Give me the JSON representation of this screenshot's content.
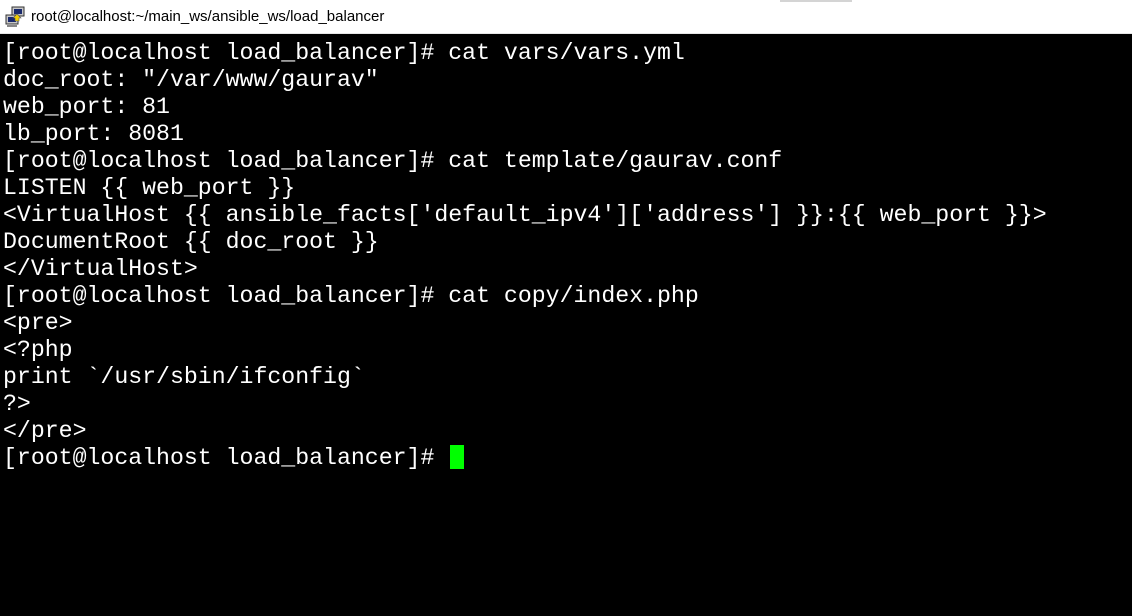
{
  "window": {
    "title": "root@localhost:~/main_ws/ansible_ws/load_balancer",
    "icon": "putty-terminal-icon"
  },
  "terminal": {
    "lines": [
      "[root@localhost load_balancer]# cat vars/vars.yml",
      "doc_root: \"/var/www/gaurav\"",
      "web_port: 81",
      "lb_port: 8081",
      "[root@localhost load_balancer]# cat template/gaurav.conf",
      "LISTEN {{ web_port }}",
      "<VirtualHost {{ ansible_facts['default_ipv4']['address'] }}:{{ web_port }}>",
      "DocumentRoot {{ doc_root }}",
      "</VirtualHost>",
      "[root@localhost load_balancer]# cat copy/index.php",
      "<pre>",
      "<?php",
      "print `/usr/sbin/ifconfig`",
      "?>",
      "</pre>",
      "[root@localhost load_balancer]# "
    ],
    "colors": {
      "background": "#000000",
      "foreground": "#ffffff",
      "cursor": "#00ff00"
    }
  }
}
